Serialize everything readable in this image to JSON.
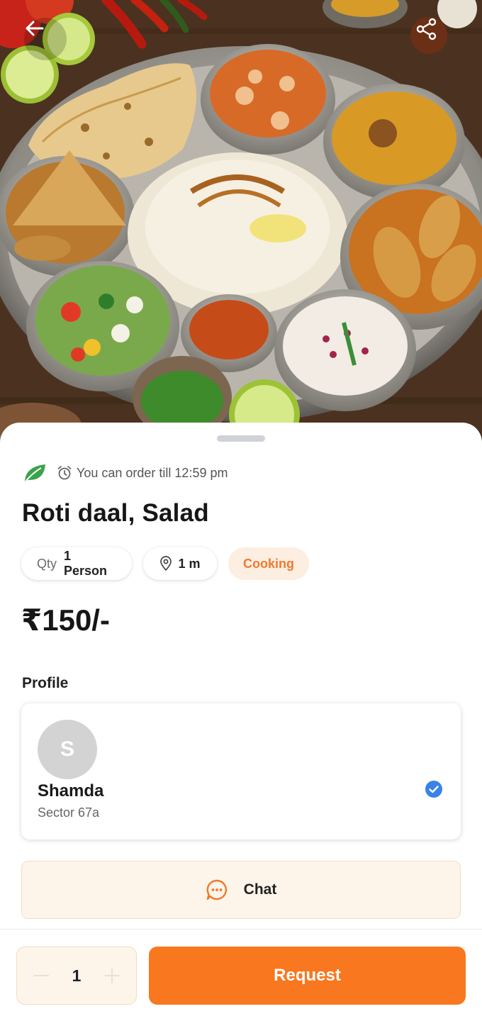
{
  "hero": {
    "image_description": "thali",
    "back_icon": "arrow-left-icon",
    "share_icon": "share-icon"
  },
  "meal": {
    "veg_icon": "leaf-icon",
    "deadline_icon": "alarm-clock-icon",
    "deadline_text": "You can order till 12:59 pm",
    "title": "Roti daal, Salad",
    "qty_label": "Qty",
    "qty_value": "1 Person",
    "distance_icon": "location-pin-icon",
    "distance": "1 m",
    "status": "Cooking",
    "price": "₹150/-"
  },
  "profile": {
    "section_label": "Profile",
    "avatar_initial": "S",
    "name": "Shamda",
    "location": "Sector 67a",
    "verified_icon": "verified-check-icon"
  },
  "chat": {
    "icon": "chat-bubble-icon",
    "label": "Chat"
  },
  "order": {
    "quantity": "1",
    "decrement_icon": "minus-icon",
    "increment_icon": "plus-icon",
    "request_label": "Request"
  },
  "colors": {
    "accent": "#f8771f",
    "status_bg": "#fdeee2",
    "status_text": "#f07a2c",
    "verified": "#3a82e8",
    "leaf": "#3aa34a"
  }
}
